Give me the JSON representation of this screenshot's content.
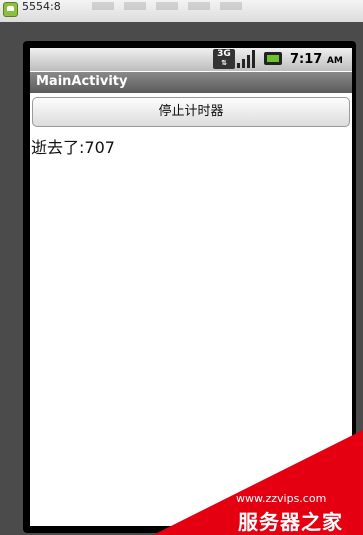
{
  "emulator": {
    "title": "5554:8"
  },
  "statusbar": {
    "network": "3G",
    "time": "7:17",
    "ampm": "AM",
    "battery_color": "#6cc32b"
  },
  "app": {
    "title": "MainActivity",
    "stop_button_label": "停止计时器",
    "elapsed_text": "逝去了:707"
  },
  "watermark": {
    "url": "www.zzvips.com",
    "brand": "服务器之家",
    "color": "#e40010"
  }
}
